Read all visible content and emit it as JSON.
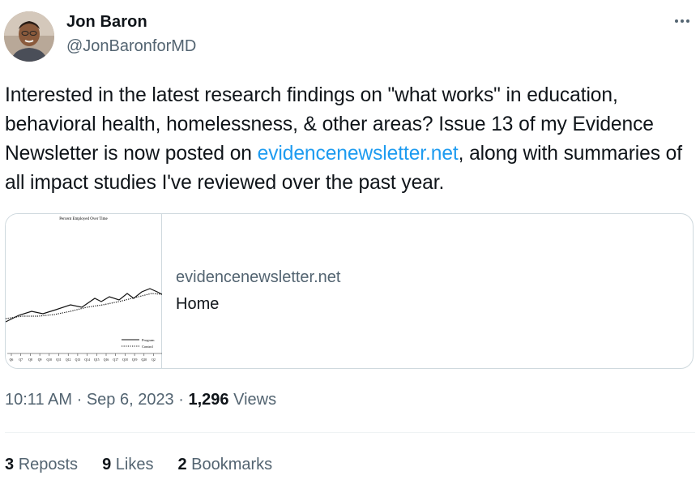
{
  "author": {
    "name": "Jon Baron",
    "handle": "@JonBaronforMD"
  },
  "tweet": {
    "text_before_link": "Interested in the latest research findings on \"what works\" in education, behavioral health, homelessness, & other areas? Issue 13 of my Evidence Newsletter is now posted on ",
    "link_text": "evidencenewsletter.net",
    "text_after_link": ", along with summaries of all impact studies I've reviewed over the past year."
  },
  "card": {
    "domain": "evidencenewsletter.net",
    "title": "Home",
    "thumbnail": {
      "title": "Percent Employed Over Time",
      "legend": [
        "Program",
        "Control"
      ],
      "x_ticks": [
        "Q6",
        "Q7",
        "Q8",
        "Q9",
        "Q10",
        "Q11",
        "Q12",
        "Q13",
        "Q14",
        "Q15",
        "Q16",
        "Q17",
        "Q18",
        "Q19",
        "Q20",
        "Q2"
      ]
    }
  },
  "meta": {
    "time": "10:11 AM",
    "separator": " · ",
    "date": "Sep 6, 2023",
    "views_count": "1,296",
    "views_label": "Views"
  },
  "stats": {
    "reposts_count": "3",
    "reposts_label": "Reposts",
    "likes_count": "9",
    "likes_label": "Likes",
    "bookmarks_count": "2",
    "bookmarks_label": "Bookmarks"
  },
  "colors": {
    "link": "#1d9bf0",
    "secondary_text": "#536471",
    "primary_text": "#0f1419",
    "border": "#cfd9de"
  },
  "icons": {
    "more": "more-horizontal-icon"
  }
}
